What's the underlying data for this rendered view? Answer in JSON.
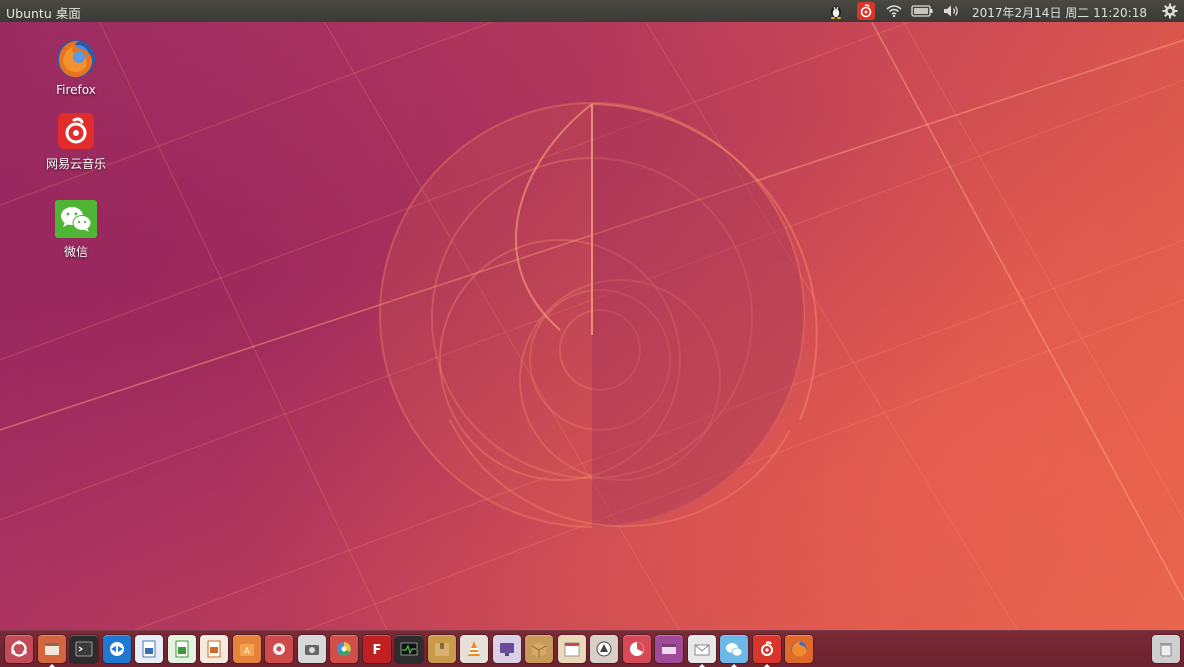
{
  "top_panel": {
    "title": "Ubuntu 桌面",
    "clock": "2017年2月14日 周二 11:20:18",
    "tray_icons": [
      "penguin-icon",
      "netease-music-icon",
      "wifi-icon",
      "battery-icon",
      "volume-icon",
      "gear-icon"
    ]
  },
  "desktop": {
    "icons": [
      {
        "label": "Firefox",
        "icon": "firefox-icon"
      },
      {
        "label": "网易云音乐",
        "icon": "netease-music-icon"
      },
      {
        "label": "微信",
        "icon": "wechat-icon"
      }
    ]
  },
  "launcher": {
    "items": [
      {
        "icon": "ubuntu-dash-icon",
        "color": "#c34a57"
      },
      {
        "icon": "files-icon",
        "color": "#d3653f"
      },
      {
        "icon": "terminal-icon",
        "color": "#2c2c2c"
      },
      {
        "icon": "teamviewer-icon",
        "color": "#1f78d1"
      },
      {
        "icon": "libreoffice-writer-icon",
        "color": "#e8eef5"
      },
      {
        "icon": "libreoffice-calc-icon",
        "color": "#e7f3e1"
      },
      {
        "icon": "libreoffice-impress-icon",
        "color": "#f6e9dd"
      },
      {
        "icon": "software-center-icon",
        "color": "#e5823b"
      },
      {
        "icon": "system-settings-icon",
        "color": "#cf4a4a"
      },
      {
        "icon": "screenshot-icon",
        "color": "#d8d8d8"
      },
      {
        "icon": "chromium-icon",
        "color": "#d14d46"
      },
      {
        "icon": "filezilla-icon",
        "color": "#c12022"
      },
      {
        "icon": "system-monitor-icon",
        "color": "#2d2d2d"
      },
      {
        "icon": "archive-manager-icon",
        "color": "#c99a4a"
      },
      {
        "icon": "vlc-icon",
        "color": "#e7e0d8"
      },
      {
        "icon": "remote-desktop-icon",
        "color": "#d9d0e6"
      },
      {
        "icon": "package-installer-icon",
        "color": "#c9995a"
      },
      {
        "icon": "calendar-icon",
        "color": "#ead9b8"
      },
      {
        "icon": "software-updater-icon",
        "color": "#d8d0c8"
      },
      {
        "icon": "disk-usage-icon",
        "color": "#d64a58"
      },
      {
        "icon": "workspace-switcher-icon",
        "color": "#a04a9a"
      },
      {
        "icon": "mail-icon",
        "color": "#e8e8e8"
      },
      {
        "icon": "wechat-icon",
        "color": "#6cb8e8"
      },
      {
        "icon": "netease-music-icon",
        "color": "#d9362b"
      },
      {
        "icon": "firefox-icon",
        "color": "#e06a2a"
      },
      {
        "icon": "trash-icon",
        "color": "#cfcfcf"
      }
    ]
  }
}
